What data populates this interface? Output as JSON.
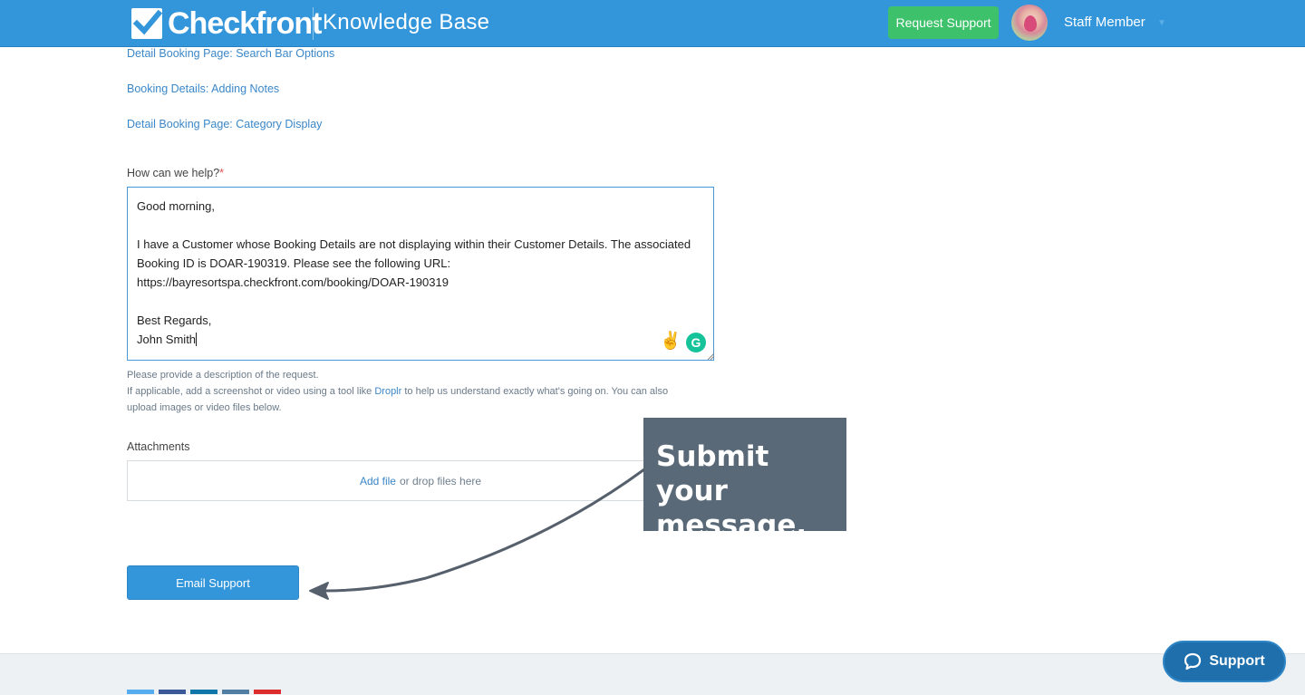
{
  "header": {
    "logo_text": "Checkfront",
    "title": "Knowledge Base",
    "request_support_label": "Request Support",
    "user_name": "Staff Member"
  },
  "related_articles": [
    {
      "label": "Detail Booking Page: Search Bar Options"
    },
    {
      "label": "Booking Details: Adding Notes"
    },
    {
      "label": "Detail Booking Page: Category Display"
    }
  ],
  "form": {
    "help_label": "How can we help?",
    "required_mark": "*",
    "message_value": "Good morning,\n\nI have a Customer whose Booking Details are not displaying within their Customer Details. The associated Booking ID is DOAR-190319. Please see the following URL: https://bayresortspa.checkfront.com/booking/DOAR-190319\n\nBest Regards,\nJohn Smith",
    "help_line1": "Please provide a description of the request.",
    "help_line2_pre": "If applicable, add a screenshot or video using a tool like ",
    "help_line2_link": "Droplr",
    "help_line2_post": " to help us understand exactly what's going on. You can also",
    "help_line3": "upload images or video files below.",
    "attachments_label": "Attachments",
    "add_file_label": "Add file",
    "drop_text": "or drop files here",
    "submit_label": "Email Support"
  },
  "callout": {
    "text": "Submit your message."
  },
  "support_widget": {
    "label": "Support"
  },
  "colors": {
    "brand_blue": "#3396db",
    "request_green": "#3ec16b",
    "callout_bg": "#5a6978",
    "link_blue": "#3b87c8"
  }
}
